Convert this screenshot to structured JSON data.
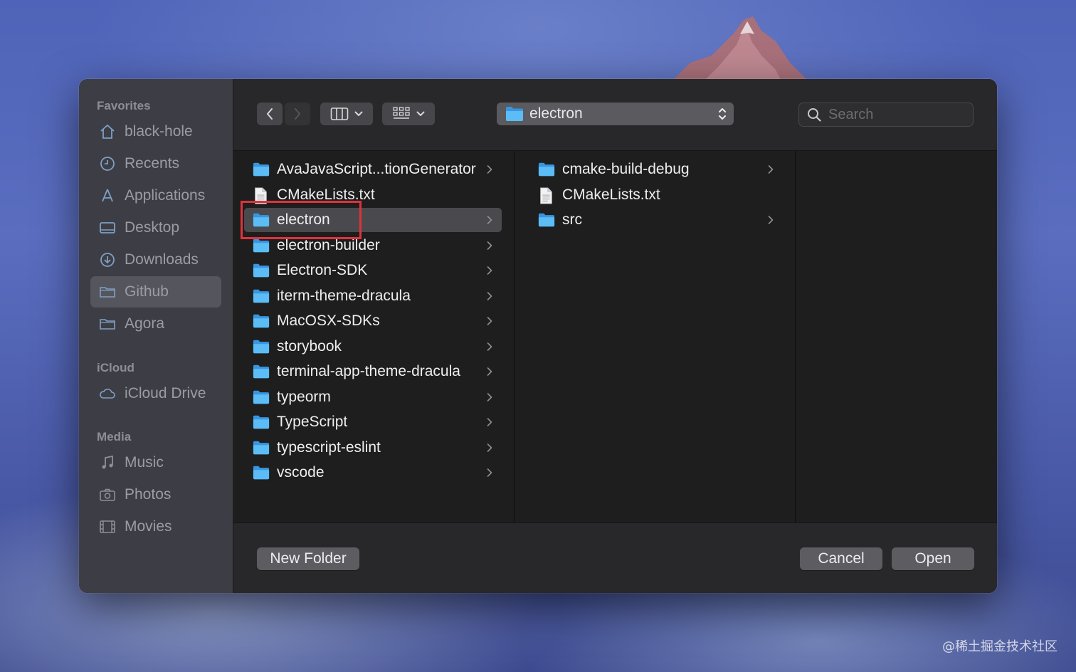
{
  "window": {
    "current_folder": "electron",
    "search_placeholder": "Search"
  },
  "sidebar": {
    "sections": [
      {
        "title": "Favorites",
        "items": [
          {
            "label": "black-hole",
            "icon": "home-icon"
          },
          {
            "label": "Recents",
            "icon": "clock-icon"
          },
          {
            "label": "Applications",
            "icon": "applications-icon"
          },
          {
            "label": "Desktop",
            "icon": "desktop-icon"
          },
          {
            "label": "Downloads",
            "icon": "download-icon"
          },
          {
            "label": "Github",
            "icon": "folder-icon",
            "selected": true
          },
          {
            "label": "Agora",
            "icon": "folder-icon"
          }
        ]
      },
      {
        "title": "iCloud",
        "items": [
          {
            "label": "iCloud Drive",
            "icon": "cloud-icon"
          }
        ]
      },
      {
        "title": "Media",
        "items": [
          {
            "label": "Music",
            "icon": "music-icon"
          },
          {
            "label": "Photos",
            "icon": "camera-icon"
          },
          {
            "label": "Movies",
            "icon": "film-icon"
          }
        ]
      }
    ]
  },
  "columns": [
    {
      "items": [
        {
          "label": "AvaJavaScript...tionGenerator",
          "type": "folder"
        },
        {
          "label": "CMakeLists.txt",
          "type": "file"
        },
        {
          "label": "electron",
          "type": "folder",
          "selected": true
        },
        {
          "label": "electron-builder",
          "type": "folder"
        },
        {
          "label": "Electron-SDK",
          "type": "folder"
        },
        {
          "label": "iterm-theme-dracula",
          "type": "folder"
        },
        {
          "label": "MacOSX-SDKs",
          "type": "folder"
        },
        {
          "label": "storybook",
          "type": "folder"
        },
        {
          "label": "terminal-app-theme-dracula",
          "type": "folder"
        },
        {
          "label": "typeorm",
          "type": "folder"
        },
        {
          "label": "TypeScript",
          "type": "folder"
        },
        {
          "label": "typescript-eslint",
          "type": "folder"
        },
        {
          "label": "vscode",
          "type": "folder"
        }
      ]
    },
    {
      "items": [
        {
          "label": "cmake-build-debug",
          "type": "folder"
        },
        {
          "label": "CMakeLists.txt",
          "type": "file"
        },
        {
          "label": "src",
          "type": "folder"
        }
      ]
    },
    {
      "items": []
    }
  ],
  "buttons": {
    "new_folder": "New Folder",
    "cancel": "Cancel",
    "open": "Open"
  },
  "watermark": "@稀土掘金技术社区",
  "colors": {
    "folder_blue": "#4aaef3",
    "highlight_red": "#e0323b",
    "selection": "#4a4a4e"
  }
}
